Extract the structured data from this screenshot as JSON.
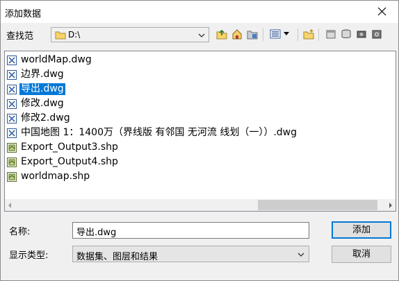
{
  "window": {
    "title": "添加数据"
  },
  "lookin": {
    "label": "查找范",
    "value": "D:\\"
  },
  "toolbar": {
    "icons": [
      "up-folder-icon",
      "home-icon",
      "connect-folder-icon",
      "list-view-icon",
      "view-dropdown-icon",
      "new-folder-icon",
      "catalog-icon",
      "database-icon",
      "disconnect-icon",
      "options-icon"
    ]
  },
  "files": [
    {
      "name": "worldMap.dwg",
      "type": "cad",
      "selected": false
    },
    {
      "name": "边界.dwg",
      "type": "cad",
      "selected": false
    },
    {
      "name": "导出.dwg",
      "type": "cad",
      "selected": true
    },
    {
      "name": "修改.dwg",
      "type": "cad",
      "selected": false
    },
    {
      "name": "修改2.dwg",
      "type": "cad",
      "selected": false
    },
    {
      "name": "中国地图 1：1400万（界线版 有邻国 无河流 线划（一））.dwg",
      "type": "cad",
      "selected": false
    },
    {
      "name": "Export_Output3.shp",
      "type": "shp",
      "selected": false
    },
    {
      "name": "Export_Output4.shp",
      "type": "shp",
      "selected": false
    },
    {
      "name": "worldmap.shp",
      "type": "shp",
      "selected": false
    }
  ],
  "form": {
    "name_label": "名称:",
    "name_value": "导出.dwg",
    "type_label": "显示类型:",
    "type_value": "数据集、图层和结果"
  },
  "buttons": {
    "add": "添加",
    "cancel": "取消"
  },
  "colors": {
    "selection": "#0078d7",
    "window_bg": "#f0f0f0",
    "default_button_border": "#0078d7"
  }
}
